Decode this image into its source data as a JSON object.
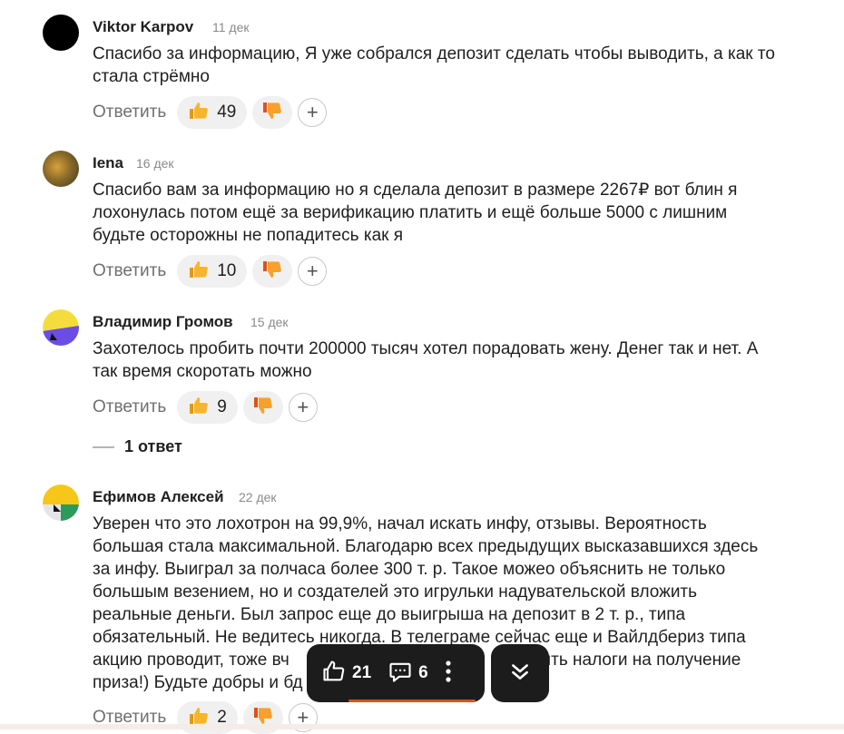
{
  "comments": [
    {
      "author": "Viktor Karpov",
      "date": "11 дек",
      "text_lines": [
        "Спасибо за информацию, Я уже собрался депозит сделать чтобы выводить, а как то",
        "стала стрёмно"
      ],
      "reply_label": "Ответить",
      "likes": "49"
    },
    {
      "author": "Iena",
      "date": "16 дек",
      "text_lines": [
        "Спасибо вам за информацию но я сделала депозит в размере 2267₽ вот блин я",
        "лохонулась потом ещё за верификацию платить и ещё больше 5000 с лишним",
        "будьте осторожны не попадитесь как я"
      ],
      "reply_label": "Ответить",
      "likes": "10"
    },
    {
      "author": "Владимир Громов",
      "date": "15 дек",
      "text_lines": [
        "Захотелось пробить почти 200000 тысяч хотел порадовать жену. Денег так и нет. А",
        "так время скоротать можно"
      ],
      "reply_label": "Ответить",
      "likes": "9",
      "answers_label": "1 ответ"
    },
    {
      "author": "Ефимов Алексей",
      "date": "22 дек",
      "text_lines": [
        "Уверен что это лохотрон на 99,9%, начал искать инфу, отзывы. Вероятность",
        "большая стала максимальной. Благодарю всех предыдущих высказавшихся здесь",
        "за инфу. Выиграл за полчаса более 300 т. р. Такое можео объяснить не только",
        "большым везением, но и создателей это игрульки надувательской вложить",
        "реальные деньги. Был запрос еще до выигрыша на депозит в 2 т. р., типа",
        "обязательный. Не ведитесь никогда. В телеграме сейчас еще и Вайлдбериз типа",
        "акцию проводит, тоже вч                                           оплатить налоги на получение",
        "приза!) Будьте добры и бд"
      ],
      "reply_label": "Ответить",
      "likes": "2"
    }
  ],
  "bottom_bar": {
    "likes": "21",
    "comments": "6"
  },
  "colors": {
    "accent_underline": "#d4541e",
    "bar_bg": "#1c1c1c"
  },
  "icons": [
    "thumbs-up-icon",
    "thumbs-down-icon",
    "plus-icon",
    "like-outline-icon",
    "comment-icon",
    "more-vertical-icon",
    "double-chevron-down-icon"
  ]
}
